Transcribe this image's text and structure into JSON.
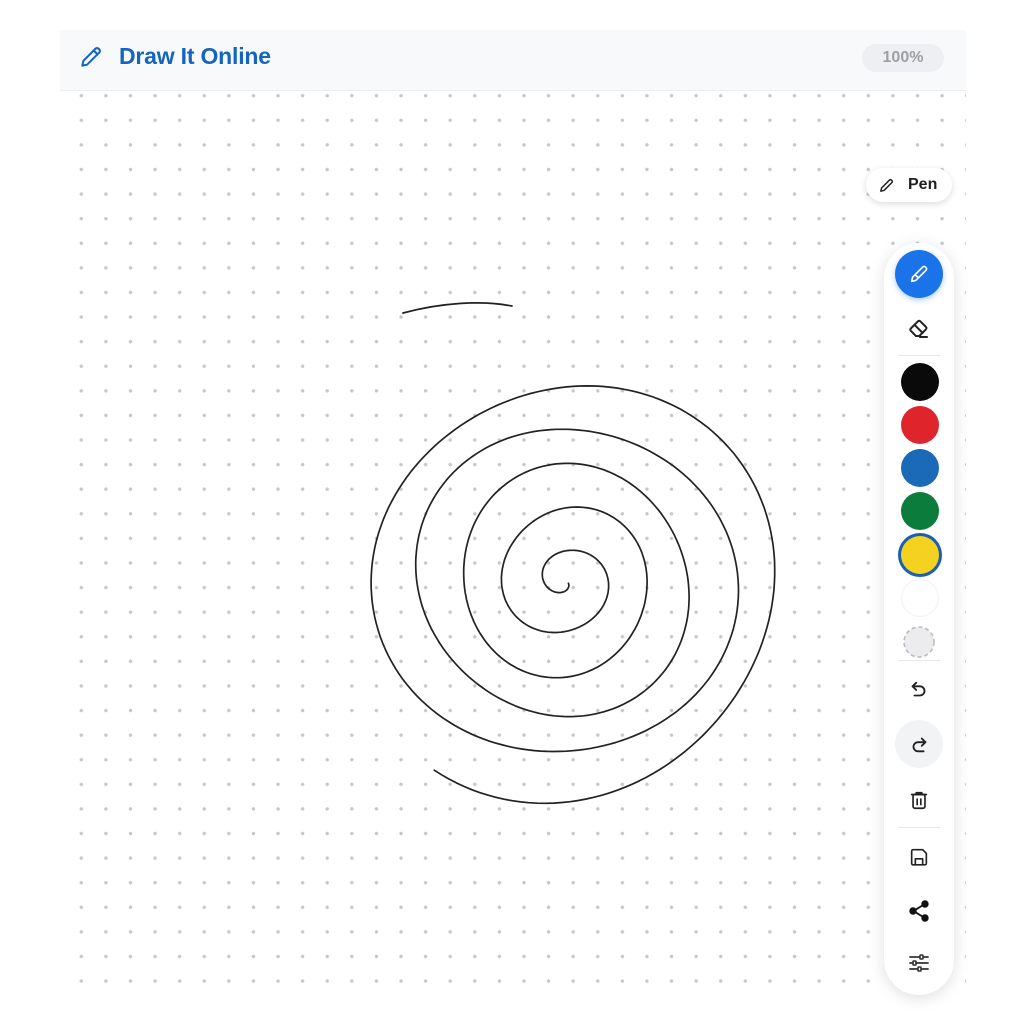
{
  "header": {
    "logo_icon": "pencil-icon",
    "title": "Draw It Online",
    "zoom": "100%"
  },
  "tool_indicator": {
    "icon": "pencil-icon",
    "label": "Pen"
  },
  "toolbar": {
    "tools": [
      {
        "name": "pen",
        "icon": "pencil-icon",
        "active": true
      },
      {
        "name": "eraser",
        "icon": "eraser-icon",
        "active": false
      }
    ],
    "colors": [
      {
        "name": "black",
        "hex": "#0a0a0a",
        "selected": false
      },
      {
        "name": "red",
        "hex": "#e0242b",
        "selected": false
      },
      {
        "name": "blue",
        "hex": "#1b6ab7",
        "selected": false
      },
      {
        "name": "green",
        "hex": "#0b7c3c",
        "selected": false
      },
      {
        "name": "yellow",
        "hex": "#f4d21f",
        "selected": true
      },
      {
        "name": "white",
        "hex": "#ffffff",
        "selected": false
      }
    ],
    "actions": [
      {
        "name": "custom-color",
        "icon": "dashed-circle-icon"
      },
      {
        "name": "undo",
        "icon": "undo-icon"
      },
      {
        "name": "redo",
        "icon": "redo-icon"
      },
      {
        "name": "clear",
        "icon": "trash-icon"
      },
      {
        "name": "save",
        "icon": "save-icon"
      },
      {
        "name": "share",
        "icon": "share-icon"
      },
      {
        "name": "settings",
        "icon": "sliders-icon"
      }
    ]
  },
  "canvas": {
    "background": "dot-grid",
    "stroke_color": "#222222",
    "content": "spiral"
  }
}
